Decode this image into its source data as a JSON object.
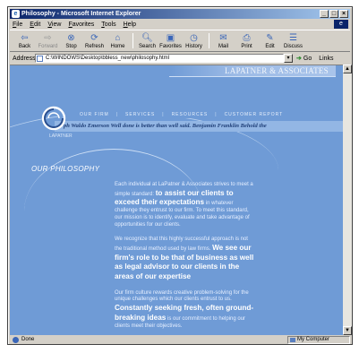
{
  "window": {
    "title": "Philosophy - Microsoft Internet Explorer",
    "minimize": "_",
    "maximize": "□",
    "close": "×",
    "app_icon": "e",
    "ie_logo": "e"
  },
  "menu": [
    "File",
    "Edit",
    "View",
    "Favorites",
    "Tools",
    "Help"
  ],
  "toolbar": [
    {
      "label": "Back",
      "glyph": "⇦",
      "icon": "back-arrow-icon",
      "enabled": true
    },
    {
      "label": "Forward",
      "glyph": "⇨",
      "icon": "forward-arrow-icon",
      "enabled": false
    },
    {
      "label": "Stop",
      "glyph": "⊗",
      "icon": "stop-icon",
      "enabled": true
    },
    {
      "label": "Refresh",
      "glyph": "⟳",
      "icon": "refresh-icon",
      "enabled": true
    },
    {
      "label": "Home",
      "glyph": "⌂",
      "icon": "home-icon",
      "enabled": true
    },
    {
      "label": "Search",
      "glyph": "🔍︎",
      "icon": "search-icon",
      "enabled": true
    },
    {
      "label": "Favorites",
      "glyph": "▣",
      "icon": "favorites-icon",
      "enabled": true
    },
    {
      "label": "History",
      "glyph": "◷",
      "icon": "history-icon",
      "enabled": true
    },
    {
      "label": "Mail",
      "glyph": "✉",
      "icon": "mail-icon",
      "enabled": true
    },
    {
      "label": "Print",
      "glyph": "⎙",
      "icon": "print-icon",
      "enabled": true
    },
    {
      "label": "Edit",
      "glyph": "✎",
      "icon": "edit-icon",
      "enabled": true
    },
    {
      "label": "Discuss",
      "glyph": "☰",
      "icon": "discuss-icon",
      "enabled": true
    }
  ],
  "address": {
    "label": "Address",
    "url": "C:\\WINDOWS\\Desktop\\bbless_new\\philosophy.html",
    "go": "Go",
    "links": "Links"
  },
  "status": {
    "text": "Done",
    "zone": "My Computer"
  },
  "page": {
    "brand": "LAPATNER & ASSOCIATES",
    "nav": [
      "OUR FIRM",
      "SERVICES",
      "RESOURCES",
      "CUSTOMER REPORT"
    ],
    "quote": "ph Waldo Emerson     Well done is better than well said.   Benjamin Franklin     Behold the",
    "logo_caption": "LAPATNER",
    "section_title": "OUR PHILOSOPHY",
    "paragraphs": [
      {
        "lead": "Each individual at LaPatner & Associates strives to meet a simple standard:",
        "highlight": "to assist our clients to exceed their expectations",
        "tail": "in whatever challenge they entrust to our firm. To meet this standard, our mission is to identify, evaluate and take advantage of opportunities for our clients."
      },
      {
        "lead": "We recognize that this highly successful approach is not the traditional method used by law firms.",
        "highlight": "We see our firm's role to be that of business as well as legal advisor to our clients in the areas of our expertise",
        "tail": ""
      },
      {
        "lead": "Our firm culture rewards creative problem-solving for the unique challenges which our clients entrust to us.",
        "highlight": "Constantly seeking fresh, often ground-breaking ideas",
        "tail": "is our commitment to helping our clients meet their objectives."
      }
    ],
    "more": ">"
  }
}
